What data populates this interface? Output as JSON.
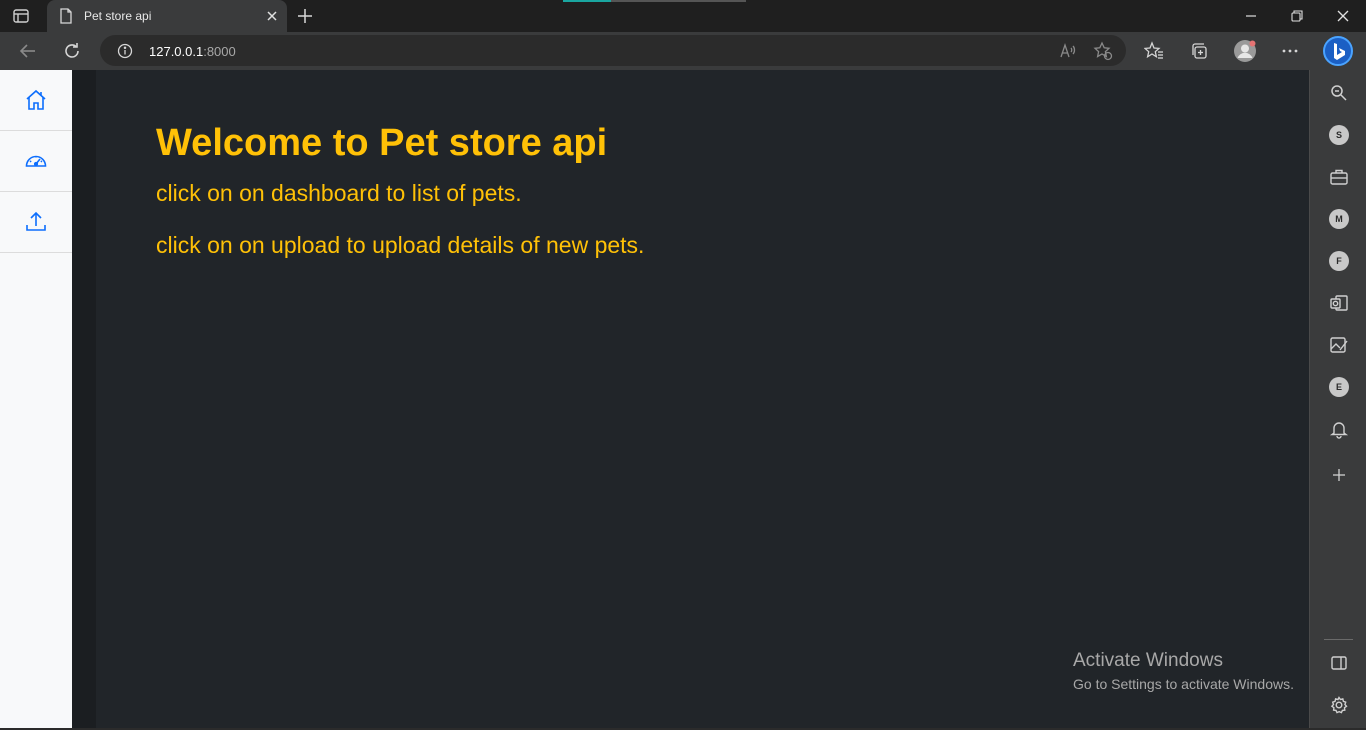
{
  "browser": {
    "tab": {
      "title": "Pet store api"
    },
    "address": {
      "host": "127.0.0.1",
      "port": ":8000"
    }
  },
  "sidebar": {
    "items": [
      {
        "name": "home",
        "icon": "home-icon"
      },
      {
        "name": "dashboard",
        "icon": "speedometer-icon"
      },
      {
        "name": "upload",
        "icon": "upload-icon"
      }
    ]
  },
  "main": {
    "heading": "Welcome to Pet store api",
    "paragraphs": [
      "click on on dashboard to list of pets.",
      "click on on upload to upload details of new pets."
    ]
  },
  "right_sidebar": {
    "letters": [
      "S",
      "M",
      "F",
      "E"
    ]
  },
  "watermark": {
    "title": "Activate Windows",
    "subtitle": "Go to Settings to activate Windows."
  },
  "colors": {
    "accent": "#ffc107",
    "content_bg": "#212529",
    "nav_icon": "#0d6efd",
    "edge_badge": "#1a73e8"
  }
}
